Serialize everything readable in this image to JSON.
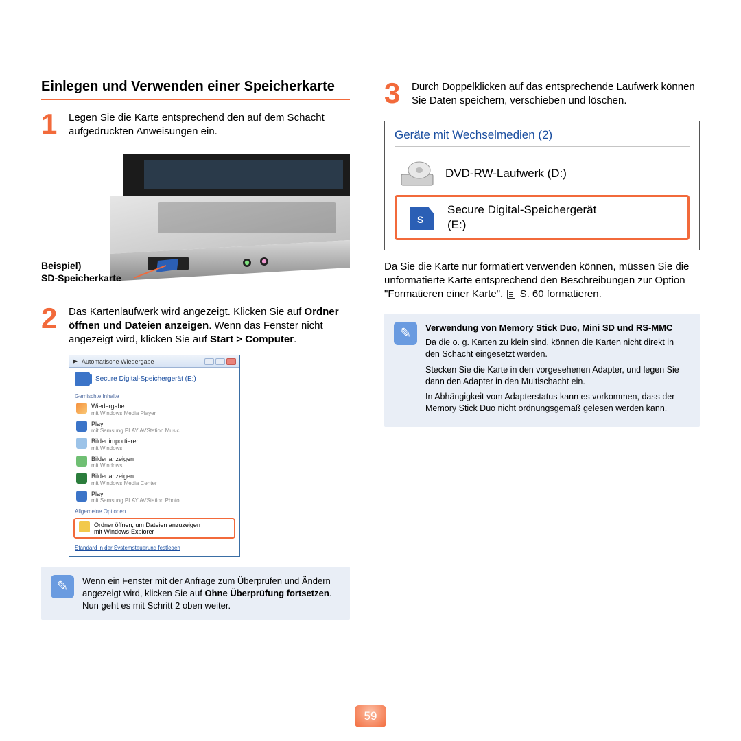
{
  "title": "Einlegen und Verwenden einer Speicherkarte",
  "steps": {
    "s1": {
      "num": "1",
      "text": "Legen Sie die Karte entsprechend den auf dem Schacht aufgedruckten Anweisungen ein."
    },
    "s2": {
      "num": "2",
      "pre": "Das Kartenlaufwerk wird angezeigt. Klicken Sie auf ",
      "b1": "Ordner öffnen und Dateien anzeigen",
      "mid": ". Wenn das Fenster nicht angezeigt wird, klicken Sie auf ",
      "b2": "Start > Computer",
      "post": "."
    },
    "s3": {
      "num": "3",
      "text": "Durch Doppelklicken auf das entsprechende Laufwerk können Sie Daten speichern, verschieben und löschen."
    }
  },
  "sd_label_line1": "Beispiel)",
  "sd_label_line2": "SD-Speicherkarte",
  "autoplay": {
    "title": "Automatische Wiedergabe",
    "device": "Secure Digital-Speichergerät (E:)",
    "sub1": "Gemischte Inhalte",
    "items": [
      {
        "l1": "Wiedergabe",
        "l2": "mit Windows Media Player",
        "icon": "ico-wmp"
      },
      {
        "l1": "Play",
        "l2": "mit Samsung PLAY AVStation Music",
        "icon": "ico-play"
      },
      {
        "l1": "Bilder importieren",
        "l2": "mit Windows",
        "icon": "ico-img"
      },
      {
        "l1": "Bilder anzeigen",
        "l2": "mit Windows",
        "icon": "ico-win"
      },
      {
        "l1": "Bilder anzeigen",
        "l2": "mit Windows Media Center",
        "icon": "ico-mc"
      },
      {
        "l1": "Play",
        "l2": "mit Samsung PLAY AVStation Photo",
        "icon": "ico-play"
      }
    ],
    "sub2": "Allgemeine Optionen",
    "selected": {
      "l1": "Ordner öffnen, um Dateien anzuzeigen",
      "l2": "mit Windows-Explorer"
    },
    "footer": "Standard in der Systemsteuerung festlegen"
  },
  "note_left": {
    "pre": "Wenn ein Fenster mit der Anfrage zum Überprüfen und Ändern angezeigt wird, klicken Sie auf ",
    "b": "Ohne Überprüfung fortsetzen",
    "post": ". Nun geht es mit Schritt 2 oben weiter."
  },
  "explorer": {
    "header": "Geräte mit Wechselmedien (2)",
    "row1": "DVD-RW-Laufwerk (D:)",
    "row2_l1": "Secure Digital-Speichergerät",
    "row2_l2": "(E:)"
  },
  "right_para": {
    "pre": "Da Sie die Karte nur formatiert verwenden können, müssen Sie die unformatierte Karte entsprechend den Beschreibungen zur Option \"Formatieren einer Karte\". ",
    "ref": "S. 60 formatieren."
  },
  "note_right": {
    "title": "Verwendung von Memory Stick Duo, Mini SD und RS-MMC",
    "p1": "Da die o. g. Karten zu klein sind, können die Karten nicht direkt in den Schacht eingesetzt werden.",
    "p2": "Stecken Sie die Karte in den vorgesehenen Adapter, und legen Sie dann den Adapter in den Multischacht ein.",
    "p3": "In Abhängigkeit vom Adapterstatus kann es vorkommen, dass der Memory Stick Duo nicht ordnungsgemäß gelesen werden kann."
  },
  "page": "59"
}
